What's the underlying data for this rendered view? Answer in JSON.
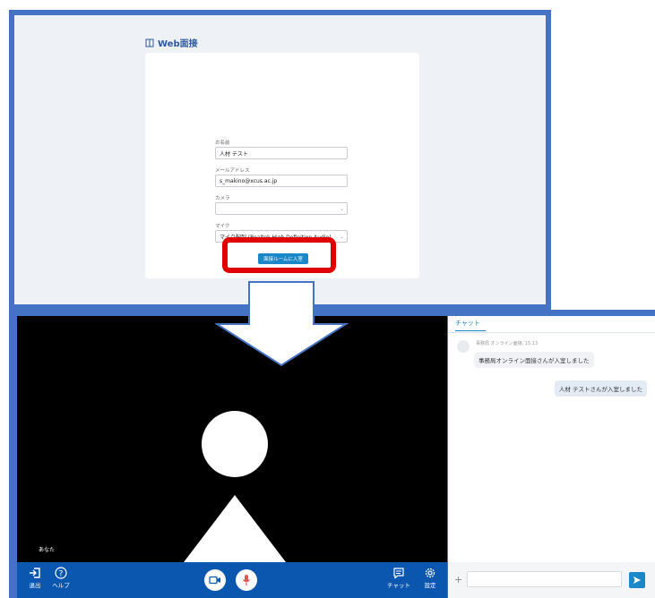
{
  "top": {
    "logo_text": "Web面接",
    "fields": [
      {
        "label": "お名前",
        "value": "人材 テスト"
      },
      {
        "label": "メールアドレス",
        "value": "s_makino@xcus.ac.jp"
      },
      {
        "label": "カメラ",
        "value": ""
      },
      {
        "label": "マイク",
        "value": "マイク配列 (Realtek High Definition Audio)"
      }
    ],
    "enter_button": "面接ルームに入室"
  },
  "video": {
    "self_label": "あなた"
  },
  "toolbar": {
    "leave": "退出",
    "help": "ヘルプ",
    "chat": "チャット",
    "settings": "設定"
  },
  "chat": {
    "tab": "チャット",
    "meta": "事務局 オンライン面接, 15:13",
    "message_left": "事務局オンライン面接さんが入室しました",
    "message_right": "人材 テストさんが入室しました"
  },
  "colors": {
    "frame": "#4472c4",
    "highlight": "#e00000",
    "primary": "#1a87c8",
    "toolbar": "#0b57b0"
  },
  "icons": [
    "book-icon",
    "chevron-down-icon",
    "down-arrow",
    "person-silhouette",
    "exit-icon",
    "help-icon",
    "camera-icon",
    "microphone-icon",
    "chat-icon",
    "gear-icon",
    "plus-icon",
    "send-icon"
  ]
}
